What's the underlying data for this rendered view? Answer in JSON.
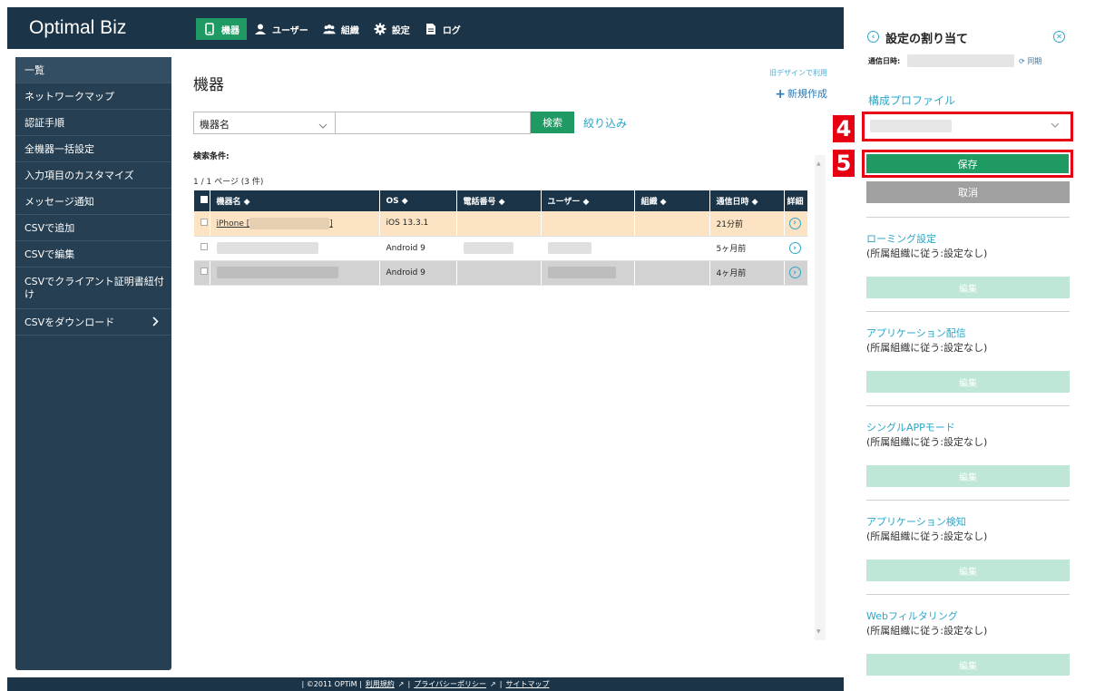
{
  "header": {
    "logo": "Optimal Biz",
    "nav": [
      {
        "label": "機器",
        "icon": "smartphone-icon",
        "active": true
      },
      {
        "label": "ユーザー",
        "icon": "user-icon",
        "active": false
      },
      {
        "label": "組織",
        "icon": "group-icon",
        "active": false
      },
      {
        "label": "設定",
        "icon": "gear-icon",
        "active": false
      },
      {
        "label": "ログ",
        "icon": "document-icon",
        "active": false
      }
    ]
  },
  "sidebar": {
    "items": [
      {
        "label": "一覧"
      },
      {
        "label": "ネットワークマップ"
      },
      {
        "label": "認証手順"
      },
      {
        "label": "全機器一括設定"
      },
      {
        "label": "入力項目のカスタマイズ"
      },
      {
        "label": "メッセージ通知"
      },
      {
        "label": "CSVで追加"
      },
      {
        "label": "CSVで編集"
      },
      {
        "label": "CSVでクライアント証明書紐付け"
      },
      {
        "label": "CSVをダウンロード"
      }
    ]
  },
  "main": {
    "title": "機器",
    "old_design_link": "旧デザインで利用",
    "new_create": "新規作成",
    "search": {
      "field": "機器名",
      "value": "",
      "button": "検索",
      "filter": "絞り込み"
    },
    "conditions_label": "検索条件:",
    "page_count": "1 / 1 ページ (3 件)",
    "table": {
      "headers": [
        "機器名 ◆",
        "OS ◆",
        "電話番号 ◆",
        "ユーザー ◆",
        "組織 ◆",
        "通信日時 ◆",
        "詳細"
      ],
      "rows": [
        {
          "name_prefix": "iPhone [",
          "name_suffix": "]",
          "os": "iOS 13.3.1",
          "time": "21分前"
        },
        {
          "name_prefix": "",
          "name_suffix": "",
          "os": "Android 9",
          "time": "5ヶ月前"
        },
        {
          "name_prefix": "",
          "name_suffix": "",
          "os": "Android 9",
          "time": "4ヶ月前"
        }
      ]
    }
  },
  "footer": {
    "copyright": "| ©2011 OPTiM |",
    "terms": "利用規約",
    "privacy": "プライバシーポリシー",
    "sitemap": "サイトマップ",
    "sep": "|"
  },
  "panel": {
    "title": "設定の割り当て",
    "comm_label": "通信日時:",
    "sync": "同期",
    "profile_label": "構成プロファイル",
    "step4": "4",
    "step5": "5",
    "save": "保存",
    "cancel": "取消",
    "settings": [
      {
        "title": "ローミング設定",
        "value": "(所属組織に従う:設定なし)",
        "edit": "編集"
      },
      {
        "title": "アプリケーション配信",
        "value": "(所属組織に従う:設定なし)",
        "edit": "編集"
      },
      {
        "title": "シングルAPPモード",
        "value": "(所属組織に従う:設定なし)",
        "edit": "編集"
      },
      {
        "title": "アプリケーション検知",
        "value": "(所属組織に従う:設定なし)",
        "edit": "編集"
      },
      {
        "title": "Webフィルタリング",
        "value": "(所属組織に従う:設定なし)",
        "edit": "編集"
      }
    ]
  },
  "colors": {
    "header_bg": "#1b3447",
    "accent_green": "#1e9a62",
    "link_blue": "#2aa6c9",
    "highlight_red": "#e60012"
  }
}
